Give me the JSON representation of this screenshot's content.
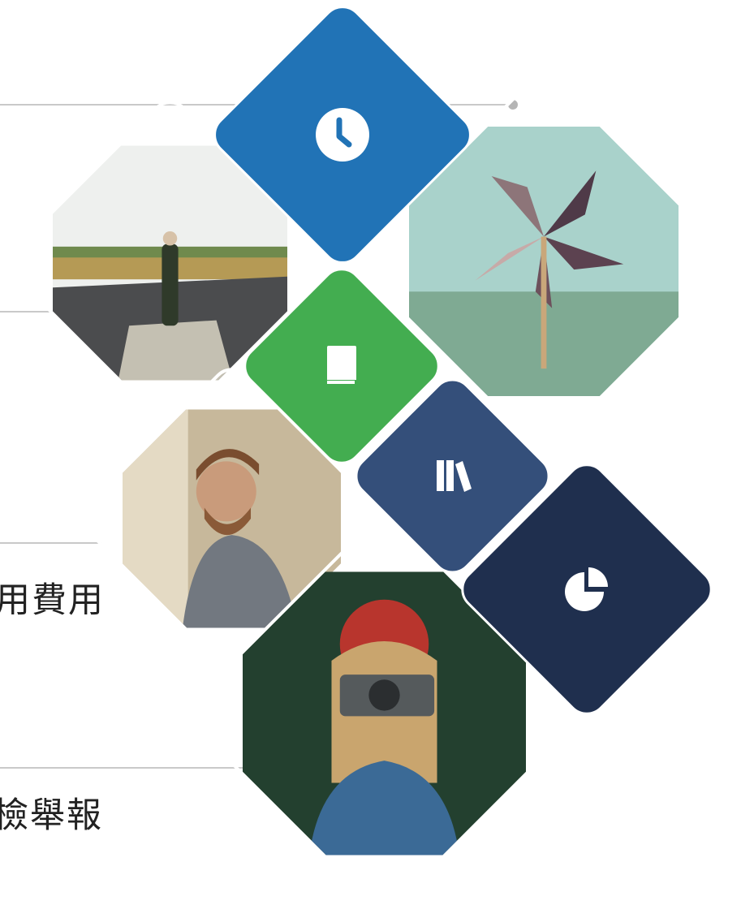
{
  "labels": {
    "fee": "用費用",
    "report": "檢舉報"
  },
  "colors": {
    "clock_tile": "#2173b6",
    "book_tile": "#43ad50",
    "library_tile": "#344f7a",
    "chart_tile": "#1f2f4e",
    "connector_line": "#c9c9c9",
    "connector_dot": "#b5b5b5"
  },
  "icons": {
    "clock": "clock-icon",
    "book": "book-icon",
    "library": "library-icon",
    "pie_chart": "pie-chart-icon"
  },
  "photos": {
    "road": "person-on-road-photo",
    "pinwheel": "pinwheel-photo",
    "man": "bearded-man-photo",
    "camera": "woman-with-camera-photo"
  }
}
